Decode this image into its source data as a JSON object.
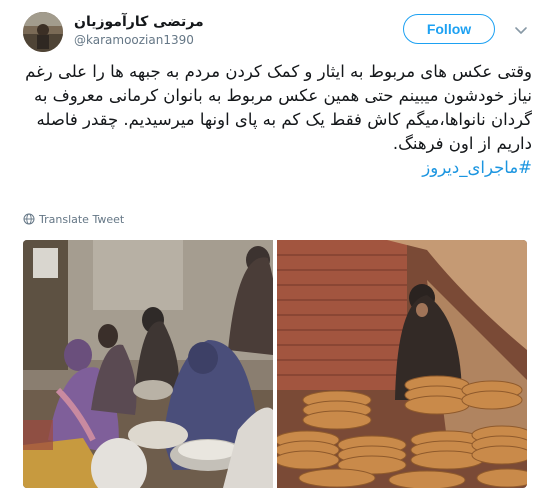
{
  "author": {
    "display_name": "مرتضی کارآموزیان",
    "handle": "@karamoozian1390"
  },
  "follow_button": {
    "label": "Follow"
  },
  "tweet": {
    "text": "وقتی عکس های مربوط به ایثار و کمک کردن مردم به جبهه ها را علی رغم نیاز خودشون میبینم حتی همین عکس مربوط به بانوان کرمانی معروف به گردان نانواها،میگم کاش فقط یک کم به پای اونها میرسیدیم. چقدر فاصله داریم از اون فرهنگ.",
    "hashtag": "#ماجرای_دیروز"
  },
  "translate": {
    "label": "Translate Tweet"
  },
  "icons": {
    "caret": "chevron-down-icon",
    "globe": "globe-icon"
  },
  "colors": {
    "accent": "#1da1f2",
    "hashtag": "#1b95e0",
    "secondary_text": "#657786"
  }
}
